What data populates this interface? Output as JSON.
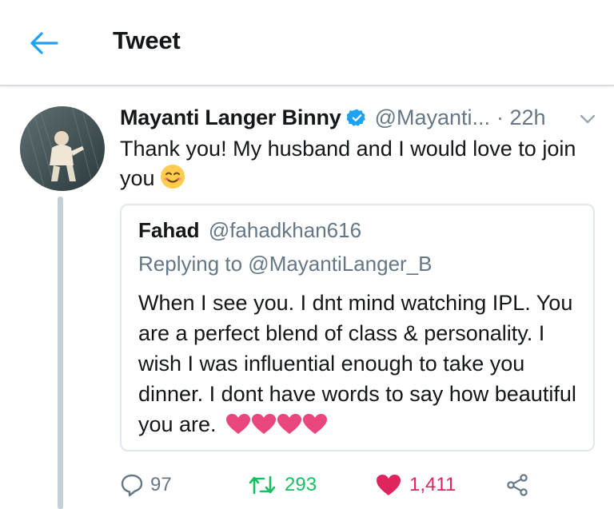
{
  "header": {
    "title": "Tweet"
  },
  "tweet": {
    "author_name": "Mayanti Langer Binny",
    "handle": "@Mayanti...",
    "time": "· 22h",
    "text": "Thank you! My husband and I would love to join you"
  },
  "quoted_tweet": {
    "author_name": "Fahad",
    "handle": "@fahadkhan616",
    "replying_to": "Replying to @MayantiLanger_B",
    "text": "When I see you. I dnt mind watching IPL. You are a perfect blend of class & personality. I wish I was influential enough to take you dinner. I dont have words to say how beautiful you are."
  },
  "actions": {
    "replies": "97",
    "retweets": "293",
    "likes": "1,411"
  },
  "colors": {
    "accent_blue": "#1da1f2",
    "retweet_green": "#17bf63",
    "like_red": "#e0245e",
    "secondary_text": "#657786",
    "heart_emoji_pink": "#e8467c"
  },
  "icons": [
    "back-arrow-icon",
    "verified-badge-icon",
    "chevron-down-icon",
    "smiling-face-emoji",
    "heart-emoji",
    "reply-icon",
    "retweet-icon",
    "like-heart-icon",
    "share-icon"
  ]
}
